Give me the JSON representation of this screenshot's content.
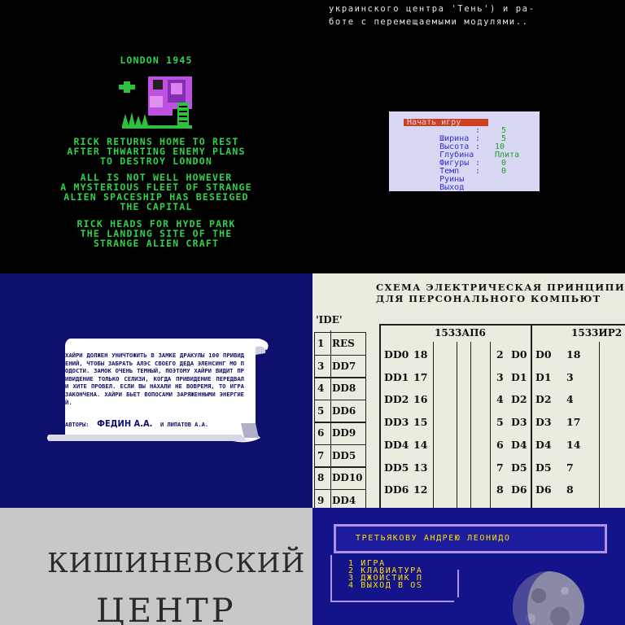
{
  "tile1": {
    "title": "LONDON 1945",
    "para1": [
      "RICK RETURNS HOME TO REST",
      "AFTER THWARTING ENEMY PLANS",
      "TO DESTROY LONDON"
    ],
    "para2": [
      "ALL IS NOT WELL HOWEVER",
      "A MYSTERIOUS FLEET OF STRANGE",
      "ALIEN SPACESHIP HAS BESEIGED",
      "THE CAPITAL"
    ],
    "para3": [
      "RICK HEADS FOR HYDE PARK",
      "THE LANDING SITE OF THE",
      "STRANGE ALIEN CRAFT"
    ],
    "text_color": "#2fd24a"
  },
  "tile2": {
    "line1": "украинского центра 'Тень') и ра-",
    "line2": "боте с перемещаемыми модулями..",
    "menu": {
      "selected": "Начать игру",
      "rows": [
        {
          "label": "Ширина",
          "sep": ":",
          "value": "5"
        },
        {
          "label": "Высота",
          "sep": ":",
          "value": "5"
        },
        {
          "label": "Глубина",
          "sep": ":",
          "value": "10"
        },
        {
          "label": "Фигуры",
          "sep": "",
          "value": "Плита"
        },
        {
          "label": "Темп",
          "sep": ":",
          "value": "0"
        },
        {
          "label": "Руины",
          "sep": ":",
          "value": "0"
        },
        {
          "label": "Выход",
          "sep": "",
          "value": ""
        }
      ]
    }
  },
  "tile3": {
    "scroll_text": "ХАЙРИ ДОЛЖЕН УНИЧТОЖИТЬ В ЗАМКЕ ДРАКУЛЫ 100 ПРИВИДЕНИЙ, ЧТОБЫ ЗАБРАТЬ АЛЭС СВОЕГО ДЕДА ЭЛЕНСИНГ МО ПОДОСТИ. ЗАМОК ОЧЕНЬ ТЕМНЫЙ, ПОЭТОМУ ХАЙРИ ВИДИТ ПРИВИДЕНИЕ ТОЛЬКО СЕЛИЗИ, КОГДА ПРИВИДЕНИЕ ПЕРЕДВАЛ И ХИТЕ ПРОВЕЛ. ЕСЛИ ВЫ НАХАЛИ НЕ ВОВРЕМЯ, ТО ИГРА ЗАКОНЧЕНА. ХАЙРИ БЬЕТ ВОПОСАМИ ЗАРЯЖЕННЫМИ ЭНЕРГИЕЙ.",
    "authors_label": "АВТОРЫ:",
    "author1": "ФЕДИН А.А.",
    "author2": "И ЛИПАТОВ А.А."
  },
  "tile4": {
    "title1": "СХЕМА ЭЛЕКТРИЧЕСКАЯ ПРИНЦИПИАЛЬНА",
    "title2": "ДЛЯ ПЕРСОНАЛЬНОГО КОМПЬЮТ",
    "connector": "'IDE'",
    "left_pins": [
      {
        "num": "1",
        "name": "RES"
      },
      {
        "num": "3",
        "name": "DD7"
      },
      {
        "num": "4",
        "name": "DD8"
      },
      {
        "num": "5",
        "name": "DD6"
      },
      {
        "num": "6",
        "name": "DD9"
      },
      {
        "num": "7",
        "name": "DD5"
      },
      {
        "num": "8",
        "name": "DD10"
      },
      {
        "num": "9",
        "name": "DD4"
      }
    ],
    "chip1": {
      "name": "1533АП6",
      "left": [
        [
          "DD0",
          "18"
        ],
        [
          "DD1",
          "17"
        ],
        [
          "DD2",
          "16"
        ],
        [
          "DD3",
          "15"
        ],
        [
          "DD4",
          "14"
        ],
        [
          "DD5",
          "13"
        ],
        [
          "DD6",
          "12"
        ]
      ],
      "right": [
        [
          "2",
          "D0"
        ],
        [
          "3",
          "D1"
        ],
        [
          "4",
          "D2"
        ],
        [
          "5",
          "D3"
        ],
        [
          "6",
          "D4"
        ],
        [
          "7",
          "D5"
        ],
        [
          "8",
          "D6"
        ]
      ]
    },
    "chip2": {
      "name": "1533ИР2",
      "left": [
        [
          "D0",
          "18"
        ],
        [
          "D1",
          "3"
        ],
        [
          "D2",
          "4"
        ],
        [
          "D3",
          "17"
        ],
        [
          "D4",
          "14"
        ],
        [
          "D5",
          "7"
        ],
        [
          "D6",
          "8"
        ]
      ]
    }
  },
  "tile5": {
    "line1": "КИШИНЕВСКИЙ",
    "line2": "ЦЕНТР"
  },
  "tile6": {
    "author": "ТРЕТЬЯКОВУ АНДРЕЮ ЛЕОНИДО",
    "menu": [
      "1 ИГРА",
      "2 КЛАВИАТУРА",
      "3 ДЖОЙСТИК П",
      "4 ВЫХОД В OS"
    ]
  }
}
